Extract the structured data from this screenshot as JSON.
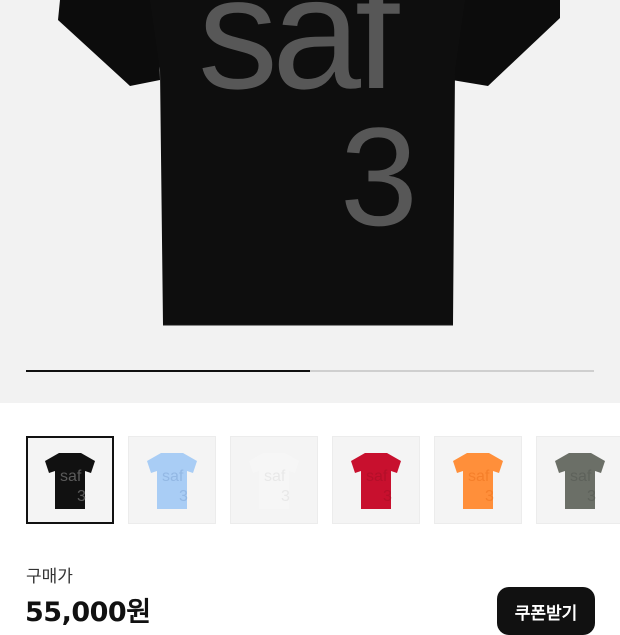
{
  "product": {
    "print_text": "saf",
    "print_number": "3",
    "gallery_progress": 0.5
  },
  "variants": [
    {
      "color": "#111111",
      "print": "#5a5a5a",
      "selected": true
    },
    {
      "color": "#a9cdf5",
      "print": "#93b8e4",
      "selected": false
    },
    {
      "color": "#f6f6f6",
      "print": "#e8e8e8",
      "selected": false
    },
    {
      "color": "#c8102e",
      "print": "#b40f29",
      "selected": false
    },
    {
      "color": "#ff8f3a",
      "print": "#f57f2a",
      "selected": false
    },
    {
      "color": "#6b6f67",
      "print": "#5e625b",
      "selected": false
    }
  ],
  "purchase": {
    "label": "구매가",
    "price": "55,000원",
    "coupon_button": "쿠폰받기"
  }
}
